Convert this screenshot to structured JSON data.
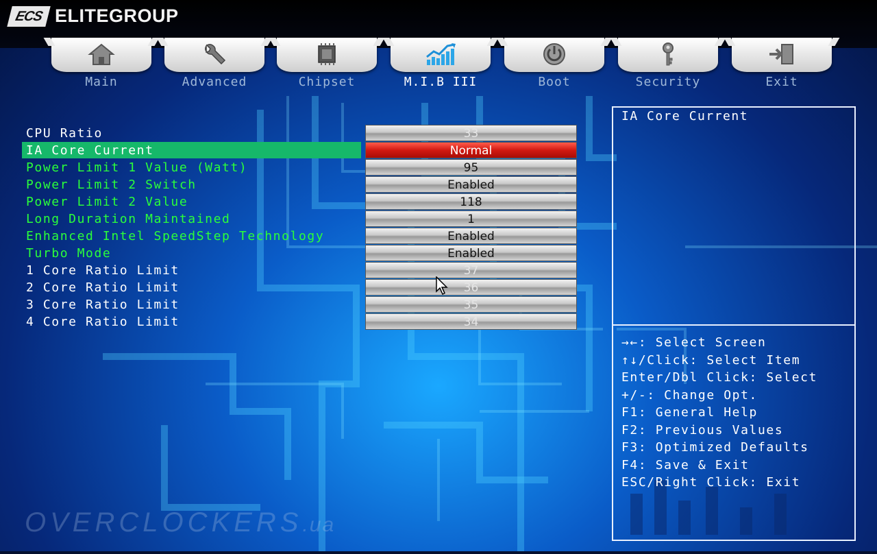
{
  "header": {
    "logo_text": "ECS",
    "brand": "ELITEGROUP"
  },
  "tabs": [
    {
      "label": "Main",
      "icon": "house-icon"
    },
    {
      "label": "Advanced",
      "icon": "wrench-icon"
    },
    {
      "label": "Chipset",
      "icon": "chip-icon"
    },
    {
      "label": "M.I.B III",
      "icon": "chart-icon"
    },
    {
      "label": "Boot",
      "icon": "power-icon"
    },
    {
      "label": "Security",
      "icon": "key-icon"
    },
    {
      "label": "Exit",
      "icon": "exit-door-icon"
    }
  ],
  "active_tab": "M.I.B III",
  "settings": [
    {
      "label": "CPU Ratio",
      "value": "33"
    },
    {
      "label": "IA Core Current",
      "value": "Normal"
    },
    {
      "label": "Power Limit 1 Value (Watt)",
      "value": "95"
    },
    {
      "label": "Power Limit 2 Switch",
      "value": "Enabled"
    },
    {
      "label": "Power Limit 2 Value",
      "value": "118"
    },
    {
      "label": "Long Duration Maintained",
      "value": "1"
    },
    {
      "label": "Enhanced Intel SpeedStep Technology",
      "value": "Enabled"
    },
    {
      "label": "Turbo Mode",
      "value": "Enabled"
    },
    {
      "label": "1 Core Ratio Limit",
      "value": "37"
    },
    {
      "label": "2 Core Ratio Limit",
      "value": "36"
    },
    {
      "label": "3 Core Ratio Limit",
      "value": "35"
    },
    {
      "label": "4 Core Ratio Limit",
      "value": "34"
    }
  ],
  "help": {
    "title": "IA Core Current",
    "keys": [
      "→←: Select Screen",
      "↑↓/Click: Select Item",
      "Enter/Dbl Click: Select",
      "+/-: Change Opt.",
      "F1: General Help",
      "F2: Previous Values",
      "F3: Optimized Defaults",
      "F4: Save & Exit",
      "ESC/Right Click: Exit"
    ]
  },
  "watermark": {
    "text": "OVERCLOCKERS",
    "suffix": ".ua"
  },
  "colors": {
    "highlight_row": "#16b86a",
    "active_value": "#d21a12",
    "editable_label": "#2bff3a",
    "readonly_label": "#ffffff"
  }
}
